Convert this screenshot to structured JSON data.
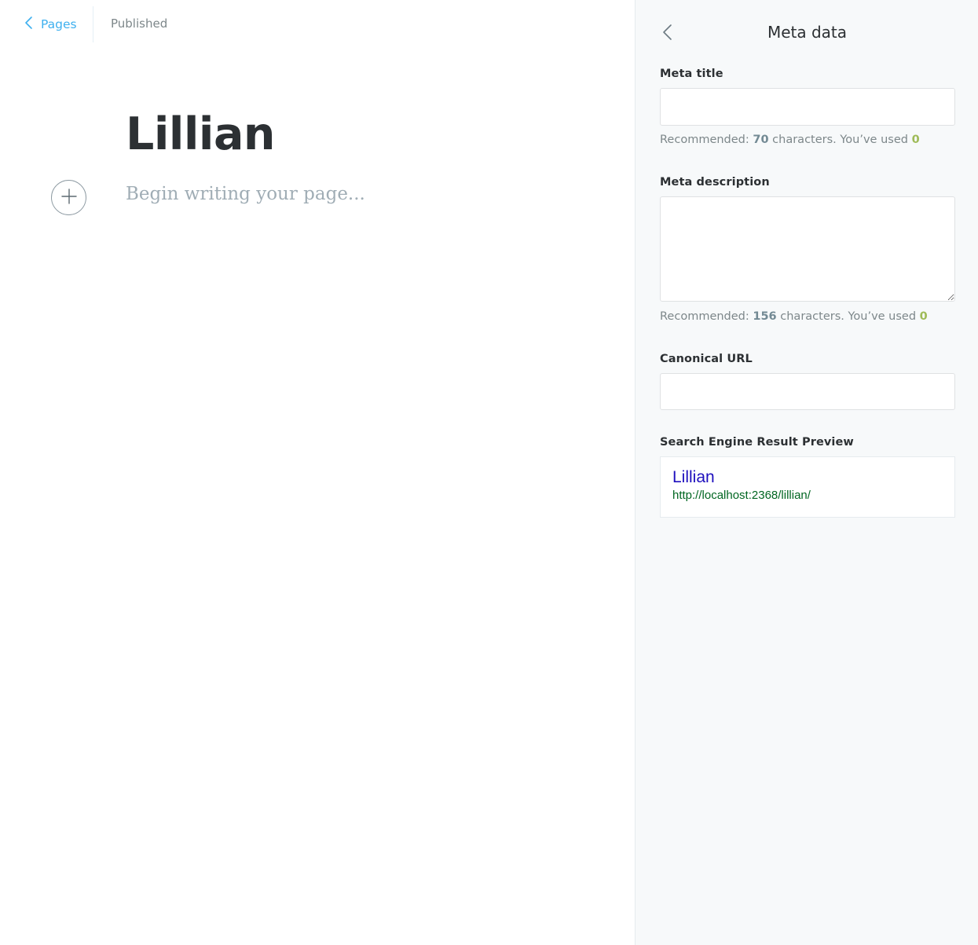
{
  "topbar": {
    "back_label": "Pages",
    "status": "Published"
  },
  "editor": {
    "title": "Lillian",
    "body_placeholder": "Begin writing your page..."
  },
  "meta_panel": {
    "title": "Meta data",
    "meta_title": {
      "label": "Meta title",
      "value": "",
      "hint_prefix": "Recommended: ",
      "recommended": "70",
      "hint_middle": " characters. You’ve used ",
      "used": "0"
    },
    "meta_description": {
      "label": "Meta description",
      "value": "",
      "hint_prefix": "Recommended: ",
      "recommended": "156",
      "hint_middle": " characters. You’ve used ",
      "used": "0"
    },
    "canonical_url": {
      "label": "Canonical URL",
      "value": ""
    },
    "serp_preview": {
      "label": "Search Engine Result Preview",
      "title": "Lillian",
      "url": "http://localhost:2368/lillian/"
    }
  },
  "colors": {
    "accent_blue": "#3eb0ef",
    "used_count_green": "#9fbb58",
    "serp_title": "#1e0fbe",
    "serp_url": "#006621"
  },
  "icons": {
    "back": "chevron-left-icon",
    "plus": "plus-icon",
    "panel_back": "chevron-left-icon"
  }
}
